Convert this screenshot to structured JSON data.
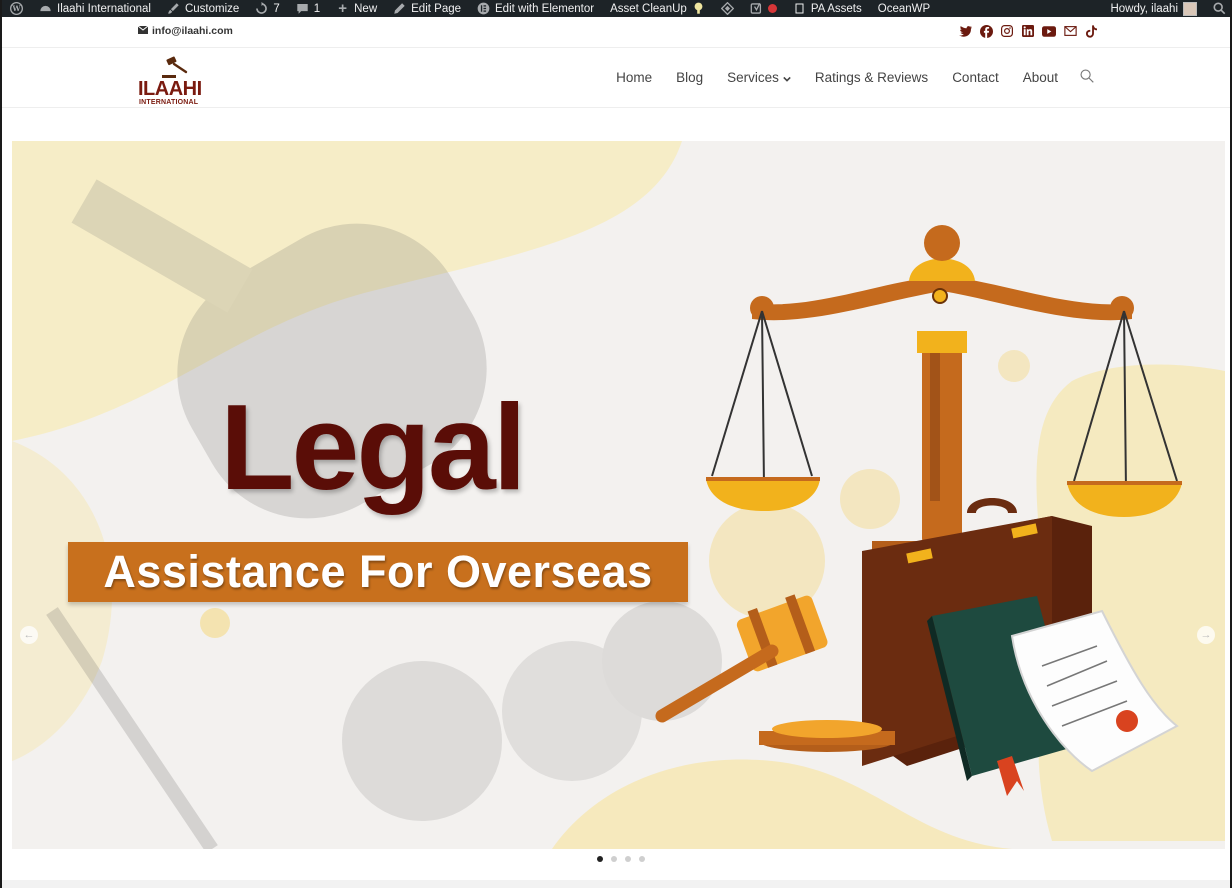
{
  "adminbar": {
    "site_name": "Ilaahi International",
    "customize": "Customize",
    "updates": "7",
    "comments": "1",
    "new": "New",
    "edit_page": "Edit Page",
    "edit_elementor": "Edit with Elementor",
    "asset_cleanup": "Asset CleanUp",
    "pa_assets": "PA Assets",
    "oceanwp": "OceanWP",
    "howdy": "Howdy, ilaahi"
  },
  "topbar": {
    "email": "info@ilaahi.com",
    "social_icons": [
      "twitter-icon",
      "facebook-icon",
      "instagram-icon",
      "linkedin-icon",
      "youtube-icon",
      "mail-icon",
      "tiktok-icon"
    ]
  },
  "logo": {
    "title": "ILAAHI",
    "subtitle": "INTERNATIONAL"
  },
  "nav": {
    "items": [
      "Home",
      "Blog",
      "Services",
      "Ratings & Reviews",
      "Contact",
      "About"
    ]
  },
  "hero": {
    "title": "Legal",
    "banner": "Assistance For Overseas",
    "slides": 4,
    "active_slide": 1
  },
  "colors": {
    "brand": "#7a1a0f",
    "banner": "#c8701d",
    "admin_bg": "#1d2327"
  }
}
